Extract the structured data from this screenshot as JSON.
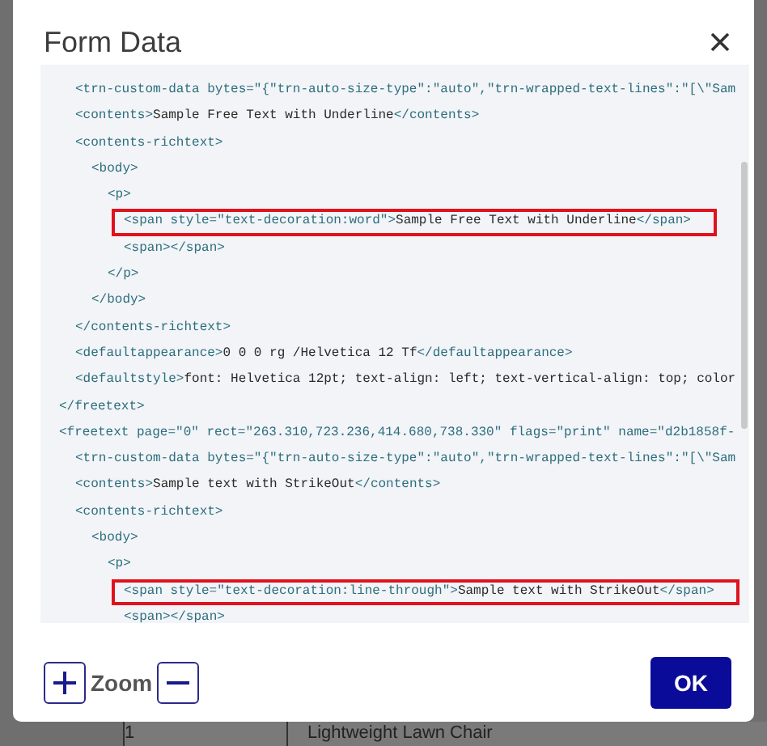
{
  "dialog": {
    "title": "Form Data",
    "code_lines": [
      {
        "children": [
          {
            "text": "<trn-custom-data bytes=\"{\"trn-auto-size-type\":\"auto\",\"trn-wrapped-text-lines\":\"[\\\"Sam",
            "highlighted": false
          },
          {
            "text": "<contents>Sample Free Text with Underline</contents>",
            "highlighted": false
          },
          {
            "text": "<contents-richtext>",
            "highlighted": false,
            "children": [
              {
                "text": "<body>",
                "highlighted": false,
                "children": [
                  {
                    "text": "<p>",
                    "highlighted": false,
                    "children": [
                      {
                        "text": "<span style=\"text-decoration:word\">Sample Free Text with Underline</span>",
                        "highlighted": true
                      },
                      {
                        "text": "<span></span>",
                        "highlighted": false
                      }
                    ]
                  },
                  {
                    "text": "</p>",
                    "highlighted": false
                  }
                ]
              },
              {
                "text": "</body>",
                "highlighted": false
              }
            ]
          },
          {
            "text": "</contents-richtext>",
            "highlighted": false
          },
          {
            "text": "<defaultappearance>0 0 0 rg /Helvetica 12 Tf</defaultappearance>",
            "highlighted": false
          },
          {
            "text": "<defaultstyle>font: Helvetica 12pt; text-align: left; text-vertical-align: top; color",
            "highlighted": false
          }
        ]
      },
      {
        "text": "</freetext>",
        "highlighted": false
      },
      {
        "text": "<freetext page=\"0\" rect=\"263.310,723.236,414.680,738.330\" flags=\"print\" name=\"d2b1858f-",
        "highlighted": false,
        "children": [
          {
            "text": "<trn-custom-data bytes=\"{\"trn-auto-size-type\":\"auto\",\"trn-wrapped-text-lines\":\"[\\\"Sam",
            "highlighted": false
          },
          {
            "text": "<contents>Sample text with StrikeOut</contents>",
            "highlighted": false
          },
          {
            "text": "<contents-richtext>",
            "highlighted": false,
            "children": [
              {
                "text": "<body>",
                "highlighted": false,
                "children": [
                  {
                    "text": "<p>",
                    "highlighted": false,
                    "children": [
                      {
                        "text": "<span style=\"text-decoration:line-through\">Sample text with StrikeOut</span>",
                        "highlighted": true
                      },
                      {
                        "text": "<span></span>",
                        "highlighted": false
                      }
                    ]
                  }
                ]
              }
            ]
          }
        ]
      }
    ],
    "zoom_label": "Zoom",
    "ok_button": "OK"
  },
  "background_table": {
    "cells": [
      "1",
      "Lightweight Lawn Chair"
    ]
  }
}
